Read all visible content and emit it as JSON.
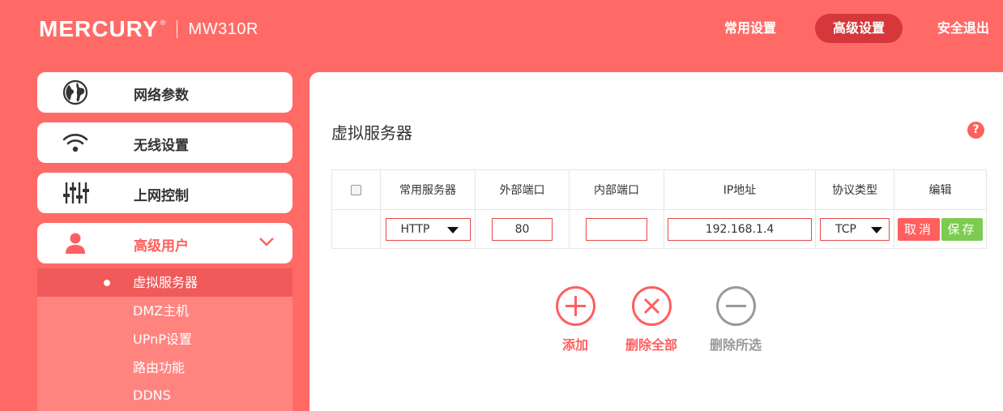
{
  "header": {
    "brand": "MERCURY",
    "model": "MW310R",
    "nav": {
      "common": "常用设置",
      "advanced": "高级设置",
      "logout": "安全退出"
    }
  },
  "sidebar": {
    "items": [
      {
        "label": "网络参数",
        "icon": "globe-icon"
      },
      {
        "label": "无线设置",
        "icon": "wifi-icon"
      },
      {
        "label": "上网控制",
        "icon": "sliders-icon"
      },
      {
        "label": "高级用户",
        "icon": "user-icon",
        "expanded": true
      }
    ],
    "subitems": [
      {
        "label": "虚拟服务器",
        "active": true
      },
      {
        "label": "DMZ主机"
      },
      {
        "label": "UPnP设置"
      },
      {
        "label": "路由功能"
      },
      {
        "label": "DDNS"
      }
    ]
  },
  "main": {
    "title": "虚拟服务器",
    "help": "?",
    "table": {
      "headers": [
        "常用服务器",
        "外部端口",
        "内部端口",
        "IP地址",
        "协议类型",
        "编辑"
      ],
      "row": {
        "service": "HTTP",
        "external_port": "80",
        "internal_port": "",
        "ip": "192.168.1.4",
        "protocol": "TCP",
        "cancel": "取消",
        "save": "保存"
      }
    },
    "actions": {
      "add": "添加",
      "delete_all": "删除全部",
      "delete_selected": "删除所选"
    }
  },
  "colors": {
    "accent": "#ff5f5f",
    "header_bg": "#ff6a67",
    "active_nav": "#d5373a",
    "save_green": "#7dcb50"
  }
}
